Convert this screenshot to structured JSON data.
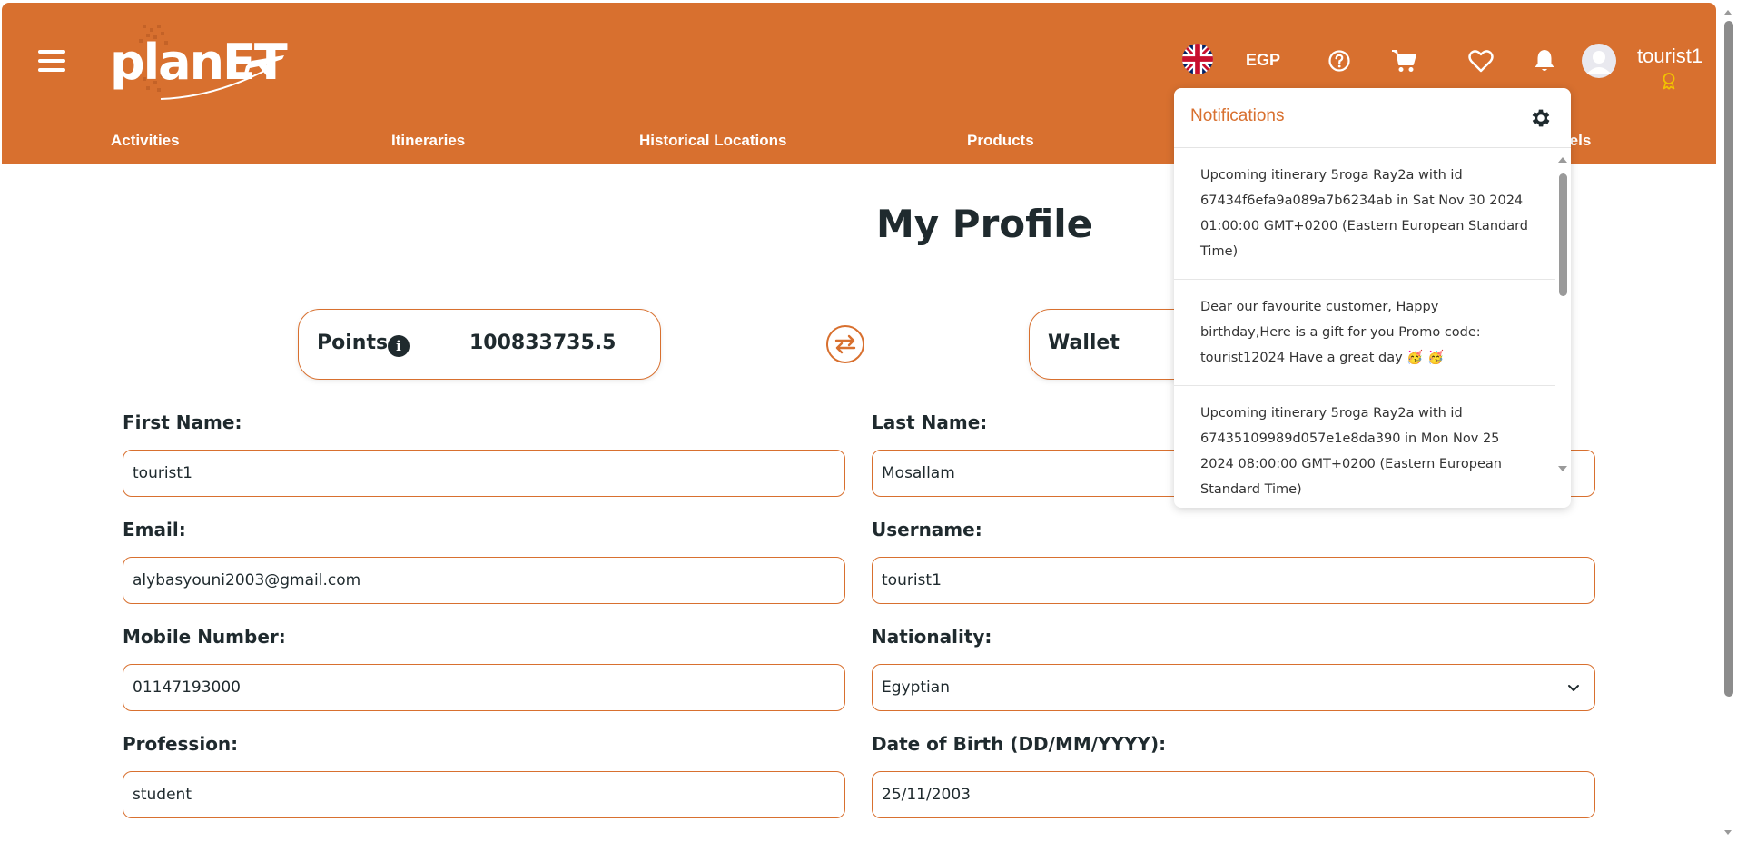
{
  "header": {
    "logo_text": "planET",
    "currency": "EGP",
    "username": "tourist1",
    "brand_color": "#d8702f",
    "icons": [
      "menu-icon",
      "help-icon",
      "cart-icon",
      "heart-icon",
      "bell-icon",
      "avatar-icon",
      "award-icon"
    ]
  },
  "nav": {
    "items": [
      "Activities",
      "Itineraries",
      "Historical Locations",
      "Products",
      "tels"
    ]
  },
  "main": {
    "title": "My Profile",
    "points_label": "Points",
    "points_value": "100833735.5",
    "wallet_label": "Wallet"
  },
  "form": {
    "first_name_label": "First Name:",
    "first_name_value": "tourist1",
    "last_name_label": "Last Name:",
    "last_name_value": "Mosallam",
    "email_label": "Email:",
    "email_value": "alybasyouni2003@gmail.com",
    "username_label": "Username:",
    "username_value": "tourist1",
    "mobile_label": "Mobile Number:",
    "mobile_value": "01147193000",
    "nationality_label": "Nationality:",
    "nationality_value": "Egyptian",
    "profession_label": "Profession:",
    "profession_value": "student",
    "dob_label": "Date of Birth (DD/MM/YYYY):",
    "dob_value": "25/11/2003"
  },
  "notifications": {
    "title": "Notifications",
    "items": [
      "Upcoming itinerary 5roga Ray2a with id 67434f6efa9a089a7b6234ab in Sat Nov 30 2024 01:00:00 GMT+0200 (Eastern European Standard Time)",
      "Dear our favourite customer, Happy birthday,Here is a gift for you Promo code: tourist12024 Have a great day 🥳 🥳",
      "Upcoming itinerary 5roga Ray2a with id 67435109989d057e1e8da390 in Mon Nov 25 2024 08:00:00 GMT+0200 (Eastern European Standard Time)"
    ]
  }
}
